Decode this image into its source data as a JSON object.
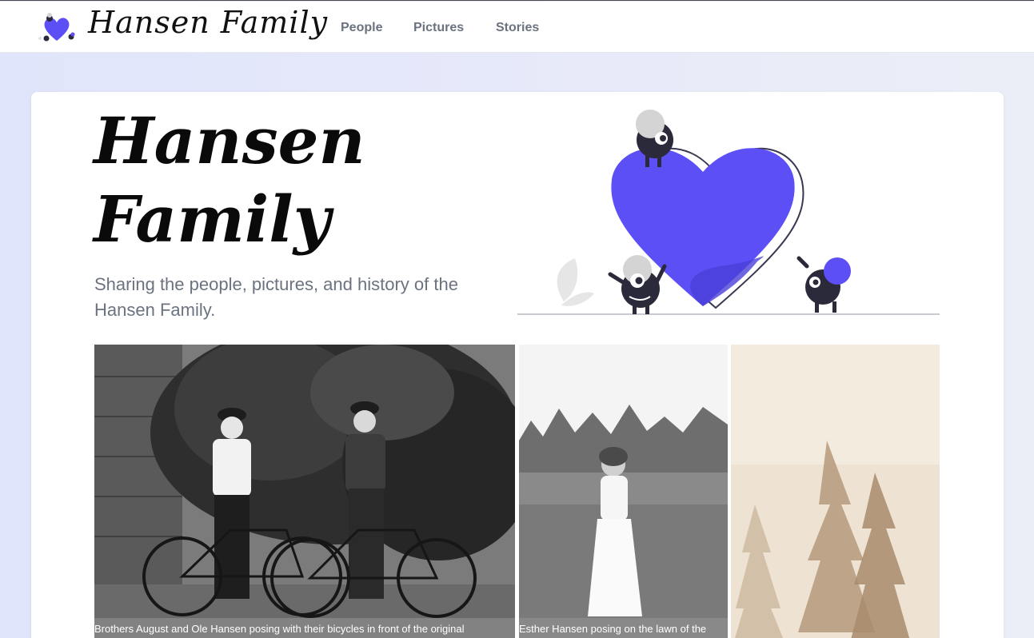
{
  "navbar": {
    "brand_name": "Hansen Family",
    "links": [
      {
        "label": "People"
      },
      {
        "label": "Pictures"
      },
      {
        "label": "Stories"
      }
    ]
  },
  "hero": {
    "title_line1": "Hansen",
    "title_line2": "Family",
    "subtitle": "Sharing the people, pictures, and history of the Hansen Family."
  },
  "gallery": [
    {
      "caption": "Brothers August and Ole Hansen posing with their bicycles in front of the original",
      "tone": "black-and-white"
    },
    {
      "caption": "Esther Hansen posing on the lawn of the",
      "tone": "black-and-white"
    },
    {
      "caption": "",
      "tone": "sepia"
    }
  ],
  "colors": {
    "accent": "#5b4ff5",
    "text": "#0a0a0a",
    "muted": "#6b7280",
    "sepia": "#e8dcc8"
  }
}
